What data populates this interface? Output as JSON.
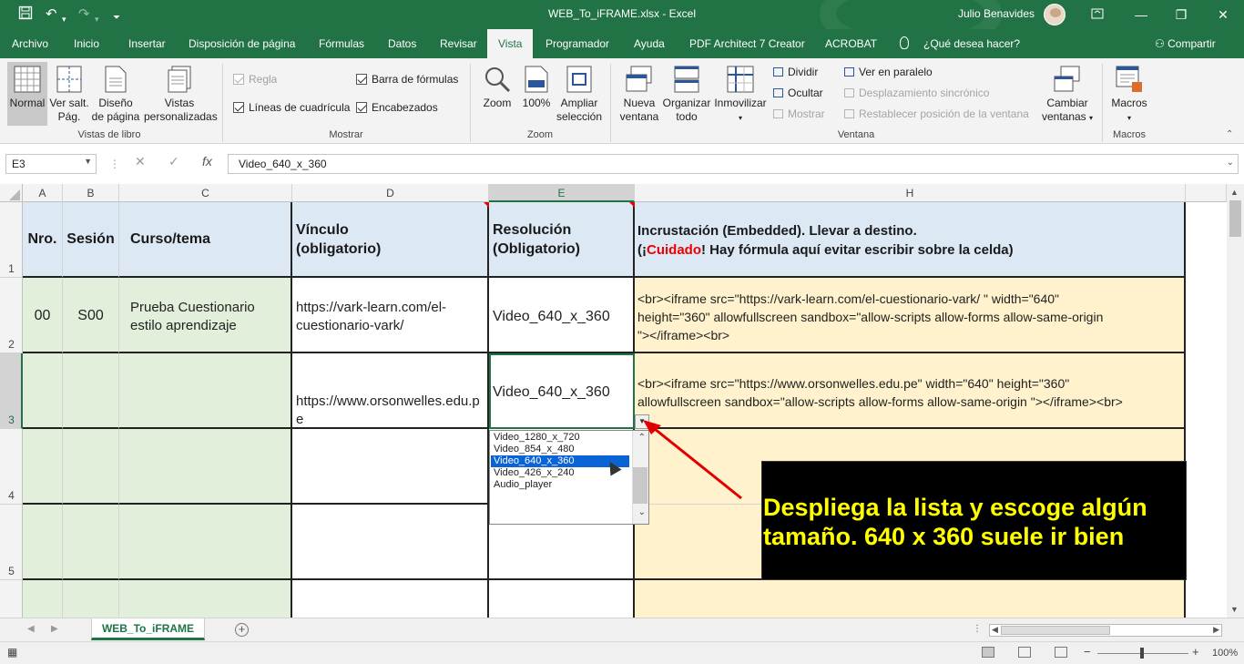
{
  "window": {
    "title": "WEB_To_iFRAME.xlsx  -  Excel",
    "user": "Julio Benavides"
  },
  "menu": {
    "tabs": [
      "Archivo",
      "Inicio",
      "Insertar",
      "Disposición de página",
      "Fórmulas",
      "Datos",
      "Revisar",
      "Vista",
      "Programador",
      "Ayuda",
      "PDF Architect 7 Creator",
      "ACROBAT"
    ],
    "tell_me": "¿Qué desea hacer?",
    "share": "Compartir"
  },
  "ribbon": {
    "vistas_libro": {
      "normal": "Normal",
      "ver_salt_1": "Ver salt.",
      "ver_salt_2": "Pág.",
      "diseno_1": "Diseño",
      "diseno_2": "de página",
      "vistas_1": "Vistas",
      "vistas_2": "personalizadas",
      "label": "Vistas de libro"
    },
    "mostrar": {
      "regla": "Regla",
      "barra": "Barra de fórmulas",
      "lineas": "Líneas de cuadrícula",
      "encabezados": "Encabezados",
      "label": "Mostrar"
    },
    "zoom": {
      "zoom": "Zoom",
      "cien": "100%",
      "ampliar_1": "Ampliar",
      "ampliar_2": "selección",
      "label": "Zoom"
    },
    "ventana": {
      "nueva_1": "Nueva",
      "nueva_2": "ventana",
      "organizar_1": "Organizar",
      "organizar_2": "todo",
      "inmovilizar": "Inmovilizar",
      "dividir": "Dividir",
      "ocultar": "Ocultar",
      "mostrar": "Mostrar",
      "paralelo": "Ver en paralelo",
      "desplazamiento": "Desplazamiento sincrónico",
      "restablecer": "Restablecer posición de la ventana",
      "cambiar_1": "Cambiar",
      "cambiar_2": "ventanas",
      "label": "Ventana"
    },
    "macros": {
      "macros": "Macros",
      "label": "Macros"
    }
  },
  "formula_bar": {
    "name_box": "E3",
    "cancel_icon": "✕",
    "enter_icon": "✓",
    "fx": "fx",
    "value": "Video_640_x_360"
  },
  "columns": [
    "A",
    "B",
    "C",
    "D",
    "E",
    "H"
  ],
  "rows": [
    "1",
    "2",
    "3",
    "4",
    "5"
  ],
  "header_row": {
    "a": "Nro.",
    "b": "Sesión",
    "c": "Curso/tema",
    "d1": "Vínculo",
    "d2": "(obligatorio)",
    "e1": "Resolución",
    "e2": "(Obligatorio)",
    "h1": "Incrustación (Embedded). Llevar a destino.",
    "h2_pre": "(¡",
    "h2_red": "Cuidado",
    "h2_post": "! Hay fórmula aquí evitar escribir sobre la celda)"
  },
  "row2": {
    "a": "00",
    "b": "S00",
    "c1": "Prueba Cuestionario",
    "c2": "estilo aprendizaje",
    "d1": "https://vark-learn.com/el-",
    "d2": "cuestionario-vark/",
    "e": "Video_640_x_360",
    "h1": "<br><iframe src=\"https://vark-learn.com/el-cuestionario-vark/ \" width=\"640\"",
    "h2": "height=\"360\" allowfullscreen sandbox=\"allow-scripts allow-forms allow-same-origin",
    "h3": "\"></iframe><br>"
  },
  "row3": {
    "d1": "https://www.orsonwelles.edu.p",
    "d2": "e",
    "e": "Video_640_x_360",
    "h1": "<br><iframe src=\"https://www.orsonwelles.edu.pe\" width=\"640\" height=\"360\"",
    "h2": "allowfullscreen sandbox=\"allow-scripts allow-forms allow-same-origin \"></iframe><br>"
  },
  "dropdown": {
    "options": [
      "Video_1280_x_720",
      "Video_854_x_480",
      "Video_640_x_360",
      "Video_426_x_240",
      "Audio_player"
    ],
    "selected": "Video_640_x_360"
  },
  "callout": {
    "line1": "Despliega la lista y escoge algún",
    "line2": "tamaño. 640 x 360 suele ir bien"
  },
  "sheet_tab": "WEB_To_iFRAME",
  "status": {
    "zoom": "100%"
  },
  "colors": {
    "excel_green": "#217346",
    "header_blue": "#dde8f5",
    "cell_green": "#e2efda",
    "cell_yellow": "#fff2cc",
    "callout_text": "#ffff00",
    "arrow_red": "#e00000"
  }
}
